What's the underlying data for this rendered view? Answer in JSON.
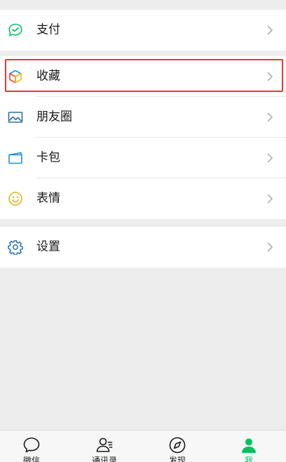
{
  "menu": {
    "payment_label": "支付",
    "favorites_label": "收藏",
    "moments_label": "朋友圈",
    "cards_label": "卡包",
    "stickers_label": "表情",
    "settings_label": "设置"
  },
  "tabbar": {
    "tabs": [
      {
        "label": "微信",
        "icon": "chat-bubble-icon"
      },
      {
        "label": "通讯录",
        "icon": "contacts-icon"
      },
      {
        "label": "发现",
        "icon": "compass-icon"
      },
      {
        "label": "我",
        "icon": "person-icon",
        "active": true
      }
    ]
  },
  "colors": {
    "accent_green": "#07c160",
    "highlight_red": "#e53935",
    "moments_blue": "#2f6ea8",
    "cards_blue": "#1c8fd6",
    "stickers_yellow": "#e6b422",
    "settings_blue": "#2b6cb0"
  }
}
